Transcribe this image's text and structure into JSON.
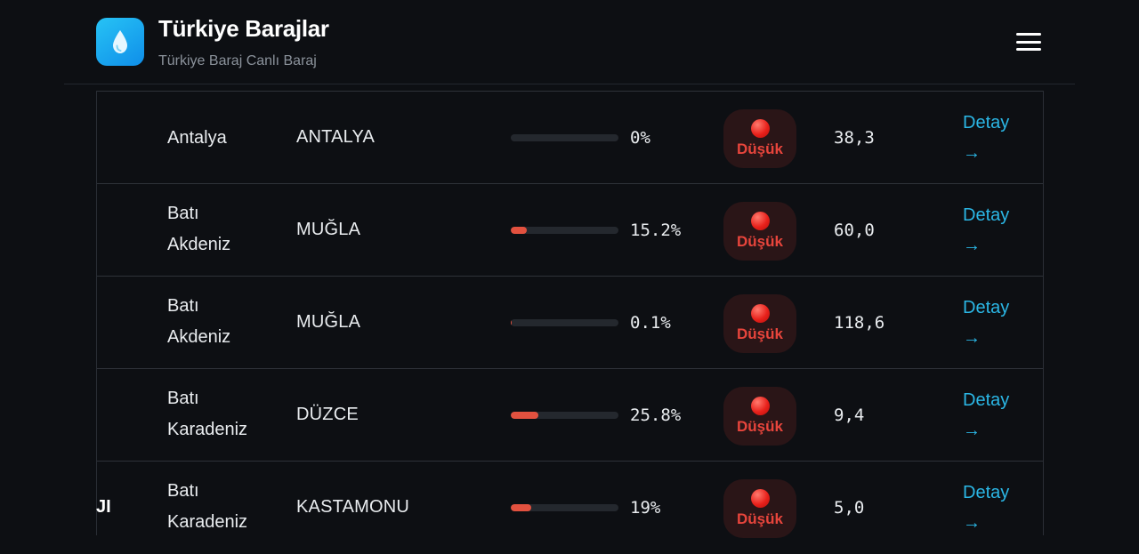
{
  "header": {
    "title": "Türkiye Barajlar",
    "subtitle": "Türkiye Baraj Canlı Baraj",
    "logo_icon": "water-drop-icon",
    "menu_icon": "hamburger-menu-icon"
  },
  "colors": {
    "accent": "#2bb7e6",
    "low_status": "#e8453c",
    "bar_fill": "#e2513f",
    "background": "#0d0f13"
  },
  "rows": [
    {
      "region": "Antalya",
      "province": "ANTALYA",
      "fill_percent": 0,
      "percent": "0%",
      "status": "Düşük",
      "volume": "38,3",
      "detail": "Detay",
      "arrow": "→"
    },
    {
      "region": "Batı Akdeniz",
      "province": "MUĞLA",
      "fill_percent": 15.2,
      "percent": "15.2%",
      "status": "Düşük",
      "volume": "60,0",
      "detail": "Detay",
      "arrow": "→"
    },
    {
      "region": "Batı Akdeniz",
      "province": "MUĞLA",
      "fill_percent": 0.1,
      "percent": "0.1%",
      "status": "Düşük",
      "volume": "118,6",
      "detail": "Detay",
      "arrow": "→"
    },
    {
      "region": "Batı Karadeniz",
      "province": "DÜZCE",
      "fill_percent": 25.8,
      "percent": "25.8%",
      "status": "Düşük",
      "volume": "9,4",
      "detail": "Detay",
      "arrow": "→"
    },
    {
      "region": "Batı Karadeniz",
      "province": "KASTAMONU",
      "fill_percent": 19,
      "percent": "19%",
      "status": "Düşük",
      "volume": "5,0",
      "detail": "Detay",
      "arrow": "→"
    }
  ],
  "partial_text": "JI"
}
